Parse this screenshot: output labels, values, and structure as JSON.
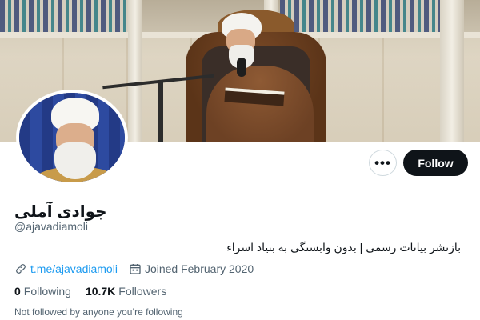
{
  "profile": {
    "display_name": "جوادی آملی",
    "handle": "@ajavadiamoli",
    "bio": "بازنشر بیانات رسمی | بدون وابستگی به بنیاد اسراء",
    "website": "t.me/ajavadiamoli",
    "joined": "Joined February 2020",
    "following_count": "0",
    "following_label": "Following",
    "followers_count": "10.7K",
    "followers_label": "Followers",
    "not_followed_text": "Not followed by anyone you’re following"
  },
  "actions": {
    "more_icon": "more-horizontal-icon",
    "follow_label": "Follow"
  },
  "icons": {
    "link": "link-icon",
    "calendar": "calendar-icon"
  },
  "colors": {
    "accent_link": "#1d9bf0",
    "follow_bg": "#0f1419",
    "secondary_text": "#536471"
  }
}
